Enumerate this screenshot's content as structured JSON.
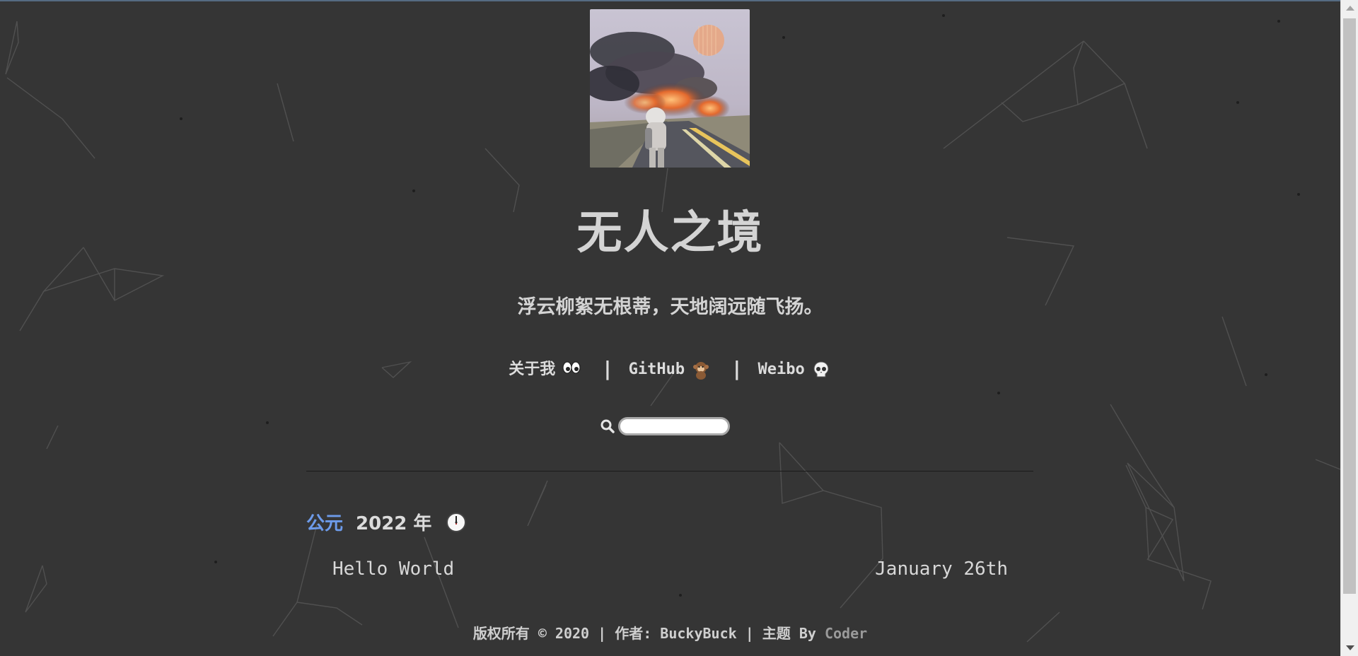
{
  "site": {
    "title": "无人之境",
    "subtitle": "浮云柳絮无根蒂，天地阔远随飞扬。"
  },
  "nav": {
    "items": [
      {
        "label": "关于我",
        "icon": "eyes-icon"
      },
      {
        "label": "GitHub",
        "icon": "monkey-icon"
      },
      {
        "label": "Weibo",
        "icon": "skull-icon"
      }
    ],
    "separator": "|"
  },
  "search": {
    "icon": "search-icon",
    "value": "",
    "placeholder": ""
  },
  "archive": {
    "era_label": "公元",
    "year_label": "2022 年",
    "icon": "clock-icon",
    "posts": [
      {
        "title": "Hello World",
        "date": "January 26th"
      }
    ]
  },
  "footer": {
    "text": "版权所有 © 2020 | 作者: BuckyBuck | 主题 By ",
    "theme_link": "Coder"
  },
  "colors": {
    "background": "#353535",
    "text": "#d4d4d4",
    "accent": "#6d9bea"
  }
}
